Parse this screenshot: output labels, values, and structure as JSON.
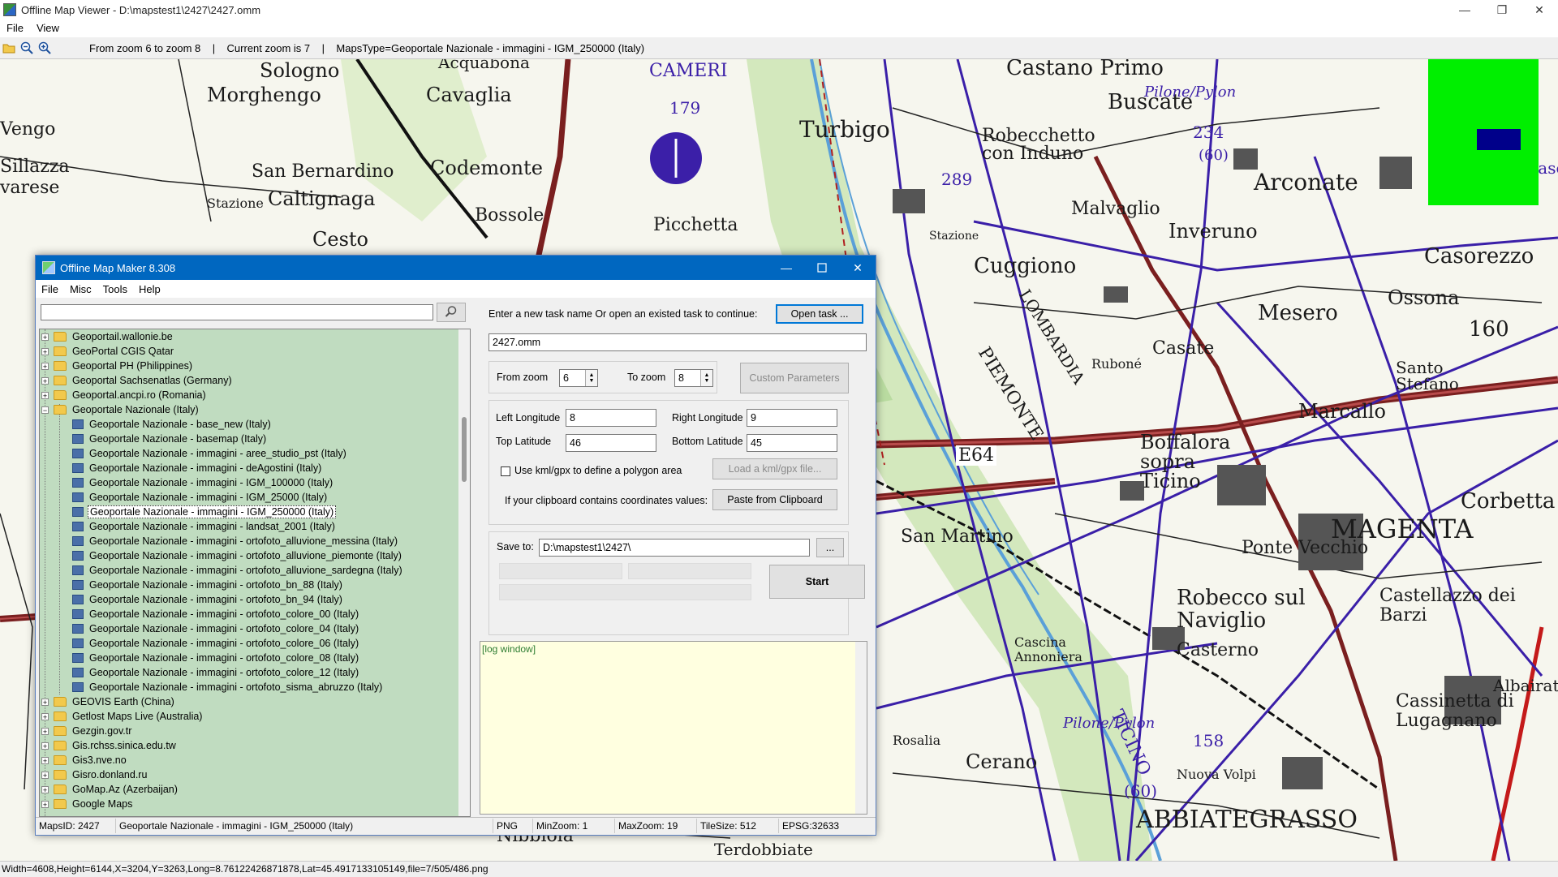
{
  "viewer": {
    "title": "Offline Map Viewer - D:\\mapstest1\\2427\\2427.omm",
    "menu": [
      "File",
      "View"
    ],
    "toolbar_status": "From zoom 6 to zoom 8    |    Current zoom is 7    |    MapsType=Geoportale Nazionale - immagini - IGM_250000 (Italy)",
    "statusbar": "Width=4608,Height=6144,X=3204,Y=3263,Long=8.76122426871878,Lat=45.4917133105149,file=7/505/486.png",
    "window_controls": [
      "—",
      "❐",
      "✕"
    ]
  },
  "map": {
    "labels": [
      "Sologno",
      "Morghengo",
      "Cavaglia",
      "Acquabona",
      "CAMERI",
      "179",
      "Turbigo",
      "Castano Primo",
      "Buscate",
      "Pilone/Pylon",
      "234",
      "(60)",
      "Robecchetto con Induno",
      "Arconate",
      "San Bernardino",
      "Caltignaga",
      "Codemonte",
      "Bossole",
      "Cesto",
      "Picchetta",
      "Stazione",
      "289",
      "Malvaglio",
      "Inveruno",
      "Casorezzo",
      "Cuggiono",
      "Ossona",
      "Mesero",
      "160",
      "Casate",
      "Santo Stefano",
      "Marcallo",
      "E64",
      "Boffalora sopra Ticino",
      "MAGENTA",
      "Corbetta",
      "San Martino",
      "Ponte Vecchio",
      "Robecco sul Naviglio",
      "Castellazzo dei Barzi",
      "Casterno",
      "Cascina Annoniera",
      "Cassinetta di Lugagnano",
      "Rosalia",
      "Cerano",
      "158",
      "(60)",
      "Nuova Volpi",
      "ABBIATEGRASSO",
      "Nibbiola",
      "Terdobbiate",
      "PIEMONTE",
      "LOMBARDIA",
      "TICINO",
      "Albairate",
      "Pilone/Pylon",
      "Ruboné",
      "Vengo",
      "Sillazza",
      "varese",
      "Stazione",
      "Casorate"
    ],
    "minimap_color": "#00ef00"
  },
  "dialog": {
    "title": "Offline Map Maker 8.308",
    "menu": [
      "File",
      "Misc",
      "Tools",
      "Help"
    ],
    "search": {
      "value": "",
      "placeholder": ""
    },
    "tree": [
      {
        "label": "Geoportail.wallonie.be",
        "type": "folder",
        "level": 0,
        "expanded": false
      },
      {
        "label": "GeoPortal CGIS Qatar",
        "type": "folder",
        "level": 0,
        "expanded": false
      },
      {
        "label": "Geoportal PH (Philippines)",
        "type": "folder",
        "level": 0,
        "expanded": false
      },
      {
        "label": "Geoportal Sachsenatlas (Germany)",
        "type": "folder",
        "level": 0,
        "expanded": false
      },
      {
        "label": "Geoportal.ancpi.ro (Romania)",
        "type": "folder",
        "level": 0,
        "expanded": false
      },
      {
        "label": "Geoportale Nazionale (Italy)",
        "type": "folder",
        "level": 0,
        "expanded": true
      },
      {
        "label": "Geoportale Nazionale - base_new (Italy)",
        "type": "map",
        "level": 1
      },
      {
        "label": "Geoportale Nazionale - basemap (Italy)",
        "type": "map",
        "level": 1
      },
      {
        "label": "Geoportale Nazionale - immagini - aree_studio_pst (Italy)",
        "type": "map",
        "level": 1
      },
      {
        "label": "Geoportale Nazionale - immagini - deAgostini (Italy)",
        "type": "map",
        "level": 1
      },
      {
        "label": "Geoportale Nazionale - immagini - IGM_100000 (Italy)",
        "type": "map",
        "level": 1
      },
      {
        "label": "Geoportale Nazionale - immagini - IGM_25000 (Italy)",
        "type": "map",
        "level": 1
      },
      {
        "label": "Geoportale Nazionale - immagini - IGM_250000 (Italy)",
        "type": "map",
        "level": 1,
        "selected": true
      },
      {
        "label": "Geoportale Nazionale - immagini - landsat_2001 (Italy)",
        "type": "map",
        "level": 1
      },
      {
        "label": "Geoportale Nazionale - immagini - ortofoto_alluvione_messina (Italy)",
        "type": "map",
        "level": 1
      },
      {
        "label": "Geoportale Nazionale - immagini - ortofoto_alluvione_piemonte (Italy)",
        "type": "map",
        "level": 1
      },
      {
        "label": "Geoportale Nazionale - immagini - ortofoto_alluvione_sardegna (Italy)",
        "type": "map",
        "level": 1
      },
      {
        "label": "Geoportale Nazionale - immagini - ortofoto_bn_88 (Italy)",
        "type": "map",
        "level": 1
      },
      {
        "label": "Geoportale Nazionale - immagini - ortofoto_bn_94 (Italy)",
        "type": "map",
        "level": 1
      },
      {
        "label": "Geoportale Nazionale - immagini - ortofoto_colore_00 (Italy)",
        "type": "map",
        "level": 1
      },
      {
        "label": "Geoportale Nazionale - immagini - ortofoto_colore_04 (Italy)",
        "type": "map",
        "level": 1
      },
      {
        "label": "Geoportale Nazionale - immagini - ortofoto_colore_06 (Italy)",
        "type": "map",
        "level": 1
      },
      {
        "label": "Geoportale Nazionale - immagini - ortofoto_colore_08 (Italy)",
        "type": "map",
        "level": 1
      },
      {
        "label": "Geoportale Nazionale - immagini - ortofoto_colore_12 (Italy)",
        "type": "map",
        "level": 1
      },
      {
        "label": "Geoportale Nazionale - immagini - ortofoto_sisma_abruzzo (Italy)",
        "type": "map",
        "level": 1
      },
      {
        "label": "GEOVIS Earth (China)",
        "type": "folder",
        "level": 0,
        "expanded": false
      },
      {
        "label": "Getlost Maps Live (Australia)",
        "type": "folder",
        "level": 0,
        "expanded": false
      },
      {
        "label": "Gezgin.gov.tr",
        "type": "folder",
        "level": 0,
        "expanded": false
      },
      {
        "label": "Gis.rchss.sinica.edu.tw",
        "type": "folder",
        "level": 0,
        "expanded": false
      },
      {
        "label": "Gis3.nve.no",
        "type": "folder",
        "level": 0,
        "expanded": false
      },
      {
        "label": "Gisro.donland.ru",
        "type": "folder",
        "level": 0,
        "expanded": false
      },
      {
        "label": "GoMap.Az (Azerbaijan)",
        "type": "folder",
        "level": 0,
        "expanded": false
      },
      {
        "label": "Google Maps",
        "type": "folder",
        "level": 0,
        "expanded": false
      }
    ],
    "task": {
      "prompt": "Enter a new task name Or open an existed task to continue:",
      "open_button": "Open task ...",
      "name_value": "2427.omm"
    },
    "zoom": {
      "from_label": "From zoom",
      "from_value": "6",
      "to_label": "To zoom",
      "to_value": "8",
      "custom_button": "Custom Parameters"
    },
    "coords": {
      "left_label": "Left Longitude",
      "left_value": "8",
      "right_label": "Right Longitude",
      "right_value": "9",
      "top_label": "Top Latitude",
      "top_value": "46",
      "bottom_label": "Bottom Latitude",
      "bottom_value": "45",
      "kml_label": "Use kml/gpx to define a polygon area",
      "kml_checked": false,
      "kml_button": "Load a kml/gpx file...",
      "clipboard_label": "If your clipboard contains coordinates values:",
      "clipboard_button": "Paste from Clipboard"
    },
    "save": {
      "label": "Save to:",
      "value": "D:\\mapstest1\\2427\\",
      "browse_button": "...",
      "start_button": "Start"
    },
    "log": "[log window]",
    "status": {
      "maps_id": "MapsID: 2427",
      "map_name": "Geoportale Nazionale - immagini - IGM_250000 (Italy)",
      "format": "PNG",
      "min_zoom": "MinZoom: 1",
      "max_zoom": "MaxZoom: 19",
      "tile_size": "TileSize: 512",
      "epsg": "EPSG:32633"
    }
  }
}
